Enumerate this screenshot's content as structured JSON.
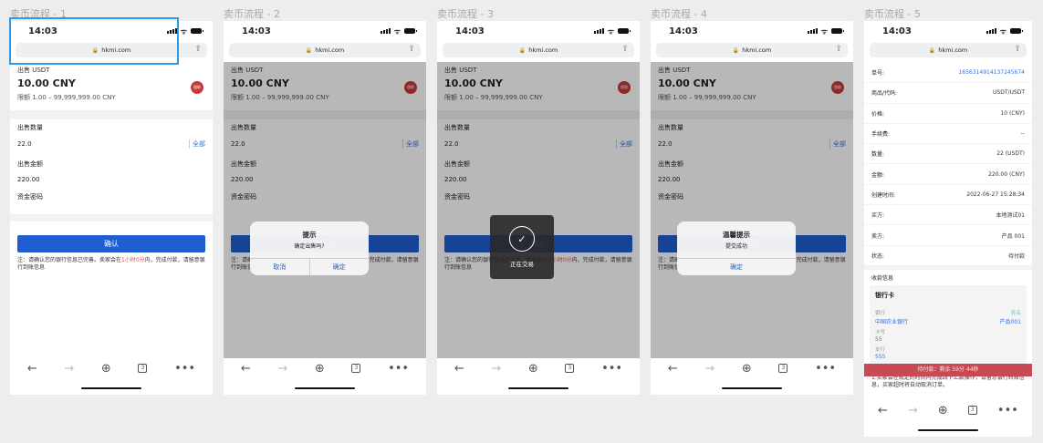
{
  "boards": [
    {
      "title": "卖币流程 - 1"
    },
    {
      "title": "卖币流程 - 2"
    },
    {
      "title": "卖币流程 - 3"
    },
    {
      "title": "卖币流程 - 4"
    },
    {
      "title": "卖币流程 - 5"
    }
  ],
  "status": {
    "time": "14:03"
  },
  "browser": {
    "url": "hkmi.com",
    "tab_count": "3"
  },
  "sell": {
    "label": "出售 USDT",
    "price": "10.00 CNY",
    "limit": "限额 1.00 – 99,999,999.00 CNY",
    "logo_text": "银联",
    "qty_label": "出售数量",
    "qty_value": "22.0",
    "all_btn": "全部",
    "amount_label": "出售金额",
    "amount_value": "220.00",
    "pwd_label": "资金密码",
    "confirm": "确认",
    "note_pre": "注：请确认您的银行信息已完善。卖家会在",
    "note_red": "1小时0分",
    "note_post": "内，完成付款，请留意银行到账信息"
  },
  "dialog_confirm": {
    "title": "提示",
    "message": "确定出售吗?",
    "cancel": "取消",
    "ok": "确定"
  },
  "toast": {
    "text": "正在交易"
  },
  "dialog_success": {
    "title": "温馨提示",
    "message": "提交成功",
    "ok": "确定"
  },
  "order": {
    "rows": [
      {
        "label": "单号:",
        "value": "1656314914137245674",
        "blue": true
      },
      {
        "label": "商品/代码:",
        "value": "USDT/USDT"
      },
      {
        "label": "价格:",
        "value": "10 (CNY)"
      },
      {
        "label": "手续费:",
        "value": "--"
      },
      {
        "label": "数量:",
        "value": "22 (USDT)"
      },
      {
        "label": "金额:",
        "value": "220.00 (CNY)"
      },
      {
        "label": "创建时间:",
        "value": "2022-06-27 15:28:34"
      },
      {
        "label": "买方:",
        "value": "本地测试01"
      },
      {
        "label": "卖方:",
        "value": "产品 001"
      },
      {
        "label": "状态:",
        "value": "待付款"
      }
    ],
    "pay_info_label": "收款信息",
    "card_title": "银行卡",
    "bank_label": "银行",
    "bank_value": "中国农业银行",
    "name_label": "姓名",
    "name_value": "产品001",
    "card_no_label": "卡号",
    "card_no_value": "55",
    "branch_label": "支行",
    "branch_value": "555",
    "instruction": "1.买家会在规定的时间内完成线下汇款操作，请留意银行转账信息，买家超时将自动取消订单。",
    "pay_bar": "待付款：剩余 59分 44秒"
  }
}
